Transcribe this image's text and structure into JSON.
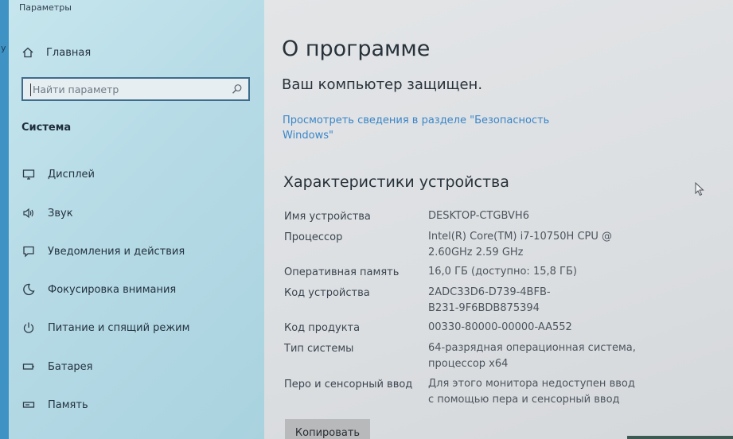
{
  "window": {
    "title": "Параметры"
  },
  "sidebar": {
    "home_label": "Главная",
    "search_placeholder": "Найти параметр",
    "section_title": "Система",
    "items": [
      {
        "label": "Дисплей",
        "icon": "display-icon"
      },
      {
        "label": "Звук",
        "icon": "speaker-icon"
      },
      {
        "label": "Уведомления и действия",
        "icon": "notifications-icon"
      },
      {
        "label": "Фокусировка внимания",
        "icon": "moon-icon"
      },
      {
        "label": "Питание и спящий режим",
        "icon": "power-icon"
      },
      {
        "label": "Батарея",
        "icon": "battery-icon"
      },
      {
        "label": "Память",
        "icon": "storage-icon"
      }
    ]
  },
  "main": {
    "title": "О программе",
    "protected_text": "Ваш компьютер защищен.",
    "security_link": "Просмотреть сведения в разделе \"Безопасность Windows\"",
    "specs_title": "Характеристики устройства",
    "specs": [
      {
        "label": "Имя устройства",
        "value": "DESKTOP-CTGBVH6"
      },
      {
        "label": "Процессор",
        "value": "Intel(R) Core(TM) i7-10750H CPU @ 2.60GHz   2.59 GHz"
      },
      {
        "label": "Оперативная память",
        "value": "16,0 ГБ (доступно: 15,8 ГБ)"
      },
      {
        "label": "Код устройства",
        "value": "2ADC33D6-D739-4BFB-B231-9F6BDB875394"
      },
      {
        "label": "Код продукта",
        "value": "00330-80000-00000-AA552"
      },
      {
        "label": "Тип системы",
        "value": "64-разрядная операционная система, процессор x64"
      },
      {
        "label": "Перо и сенсорный ввод",
        "value": "Для этого монитора недоступен ввод с помощью пера и сенсорный ввод"
      }
    ],
    "copy_button": "Копировать"
  },
  "colors": {
    "link": "#3b86c7",
    "sidebar_bg": "#b6dbe6",
    "main_bg": "#dcdfe2"
  }
}
